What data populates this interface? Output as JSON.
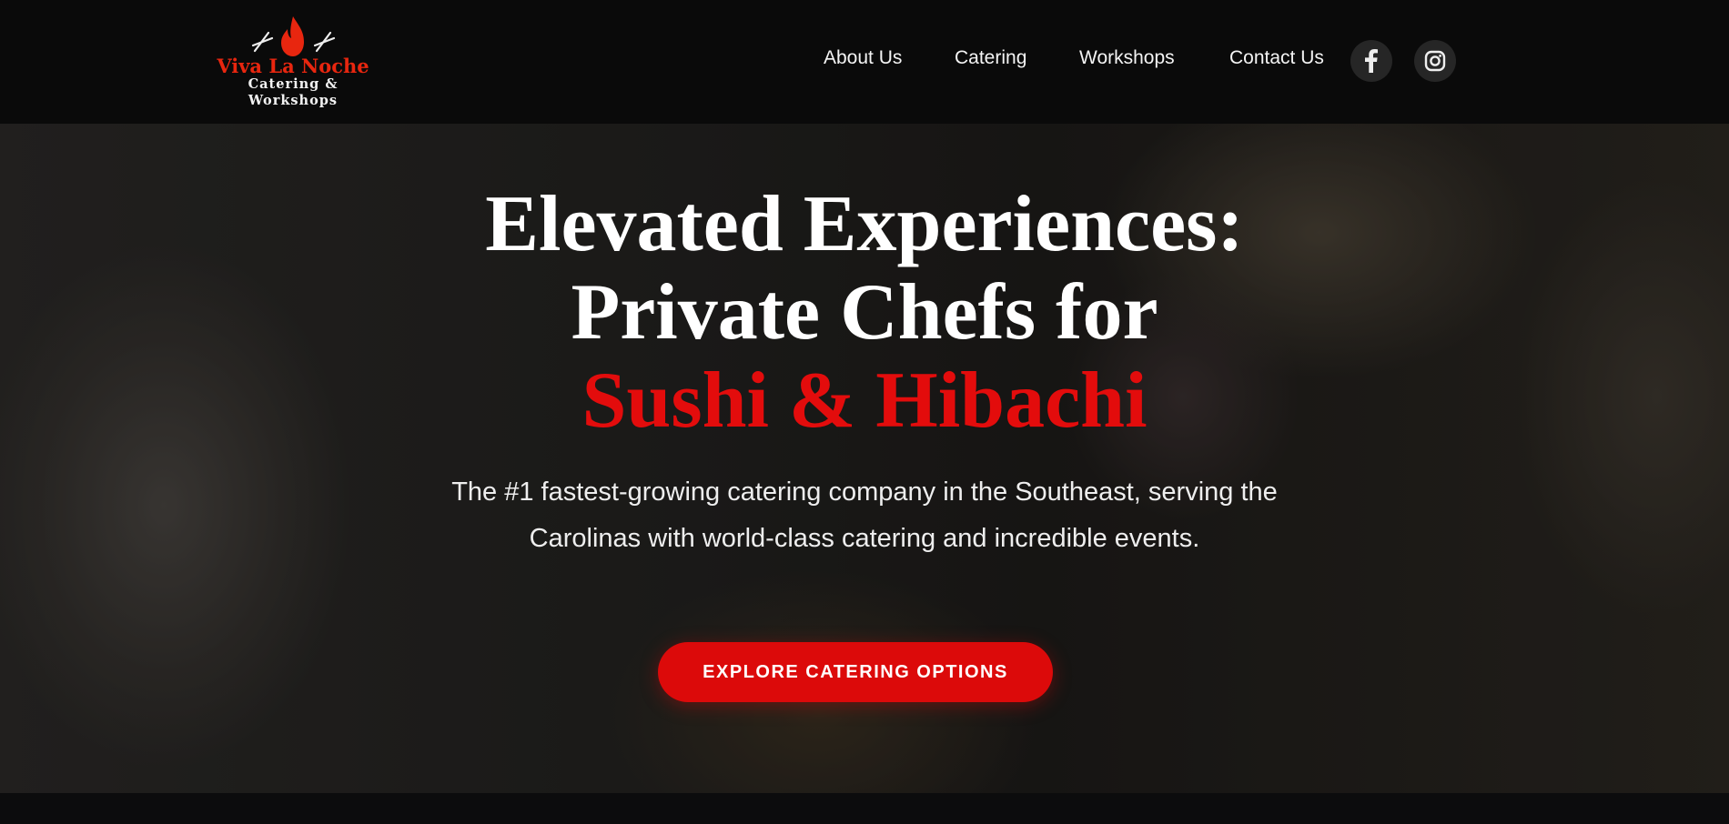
{
  "logo": {
    "name": "Viva La Noche",
    "tagline": "Catering & Workshops",
    "mark": "DBA"
  },
  "nav": {
    "items": [
      {
        "label": "About Us"
      },
      {
        "label": "Catering"
      },
      {
        "label": "Workshops"
      },
      {
        "label": "Contact Us"
      }
    ],
    "social": [
      {
        "icon": "facebook-icon"
      },
      {
        "icon": "instagram-icon"
      }
    ]
  },
  "hero": {
    "title_line1": "Elevated Experiences:",
    "title_line2": "Private Chefs for",
    "title_line3": "Sushi & Hibachi",
    "subtitle_line1": "The #1 fastest-growing catering company in the Southeast, serving the",
    "subtitle_line2": "Carolinas with world-class catering and incredible events.",
    "cta_label": "EXPLORE CATERING OPTIONS"
  },
  "colors": {
    "accent": "#e30c0c",
    "logo_red": "#e8260f",
    "header_bg": "#0a0a0a"
  }
}
